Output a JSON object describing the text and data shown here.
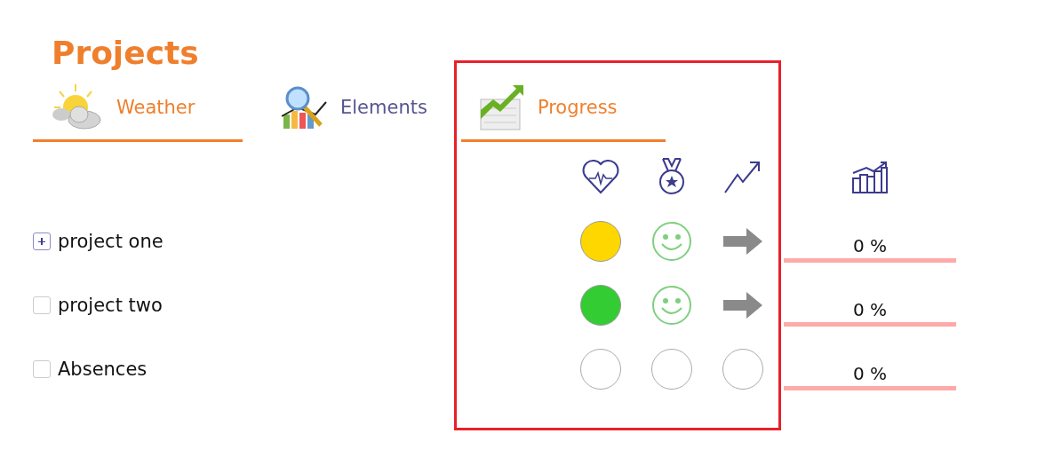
{
  "title": "Projects",
  "tabs": [
    {
      "label": "Weather",
      "selected": true
    },
    {
      "label": "Elements",
      "selected": false
    },
    {
      "label": "Progress",
      "selected": true
    }
  ],
  "rows": [
    {
      "label": "project one",
      "expandable": true,
      "color": "#ffd700",
      "smiley": true,
      "arrow": true,
      "progress": "0 %"
    },
    {
      "label": "project two",
      "expandable": false,
      "color": "#33cc33",
      "smiley": true,
      "arrow": true,
      "progress": "0 %"
    },
    {
      "label": "Absences",
      "expandable": false,
      "smiley": false,
      "arrow": false,
      "progress": "0 %"
    }
  ],
  "highlight": true
}
